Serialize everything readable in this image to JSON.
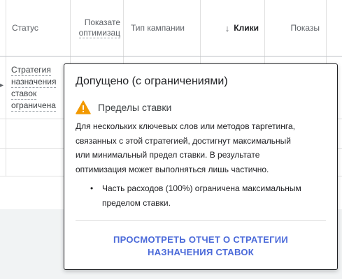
{
  "table": {
    "headers": {
      "status": "Статус",
      "optimization_line1": "Показате",
      "optimization_line2": "оптимизац",
      "campaign_type": "Тип кампании",
      "clicks_arrow": "↓",
      "clicks": "Клики",
      "impressions": "Показы"
    },
    "rows": [
      {
        "status_lines": [
          "Стратегия",
          "назначения",
          "ставок",
          "ограничена"
        ]
      }
    ]
  },
  "popover": {
    "title": "Допущено (с ограничениями)",
    "warning_icon": "warning-icon",
    "subtitle": "Пределы ставки",
    "description_lines": [
      "Для нескольких ключевых слов или методов таргетинга,",
      "связанных с этой стратегией, достигнут максимальный",
      "или минимальный предел ставки. В результате",
      "оптимизация может выполняться лишь частично."
    ],
    "bullet_lines": [
      "Часть расходов (100%) ограничена максимальным",
      "пределом ставки."
    ],
    "link_lines": [
      "ПРОСМОТРЕТЬ ОТЧЕТ О СТРАТЕГИИ",
      "НАЗНАЧЕНИЯ СТАВОК"
    ],
    "colors": {
      "warning": "#f29900",
      "link": "#4a69d9"
    }
  }
}
